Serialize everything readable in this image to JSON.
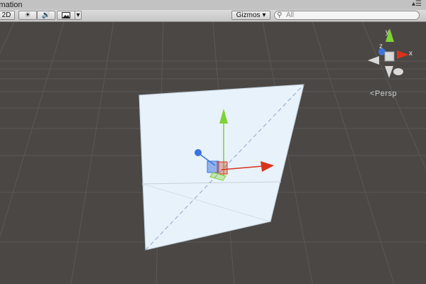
{
  "tab": {
    "title": "imation"
  },
  "toolbar": {
    "mode_2d": "2D",
    "light_icon": "sun-icon",
    "audio_icon": "speaker-icon",
    "effects_icon": "image-icon",
    "dropdown_icon": "chevron-down-icon",
    "gizmos_label": "Gizmos",
    "gizmos_arrow": "▾",
    "search_placeholder": "All"
  },
  "scene": {
    "orientation_gizmo": {
      "y_label": "y",
      "x_label": "x",
      "z_label": "z"
    },
    "projection_label": "Persp",
    "colors": {
      "background": "#4a4745",
      "grid": "#5b5856",
      "x_axis": "#d8341d",
      "y_axis": "#7fd233",
      "z_axis": "#3a74e0",
      "panel": "#e8f2fb"
    }
  }
}
